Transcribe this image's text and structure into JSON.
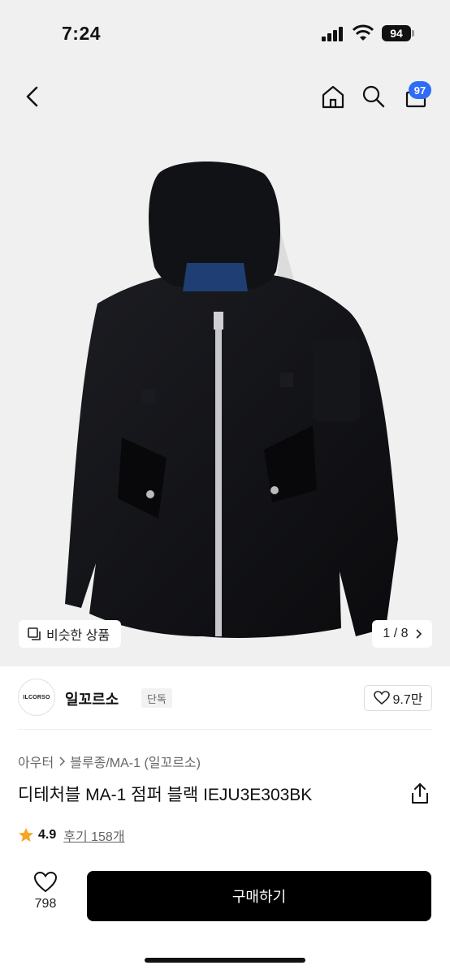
{
  "status": {
    "time": "7:24",
    "battery": "94"
  },
  "nav": {
    "back_icon": "chevron-left-icon",
    "home_icon": "home-icon",
    "search_icon": "search-icon",
    "cart_icon": "cart-icon",
    "cart_count": "97"
  },
  "gallery": {
    "similar_label": "비슷한 상품",
    "pager": "1 / 8"
  },
  "brand": {
    "logo_text": "ILCORSO",
    "name": "일꼬르소",
    "exclusive": "단독",
    "likes": "9.7만"
  },
  "product": {
    "breadcrumb": [
      "아우터",
      "블루종/MA-1 (일꼬르소)"
    ],
    "title": "디테처블 MA-1 점퍼 블랙 IEJU3E303BK",
    "rating": "4.9",
    "reviews": "후기 158개"
  },
  "action": {
    "wish_count": "798",
    "buy_label": "구매하기"
  }
}
